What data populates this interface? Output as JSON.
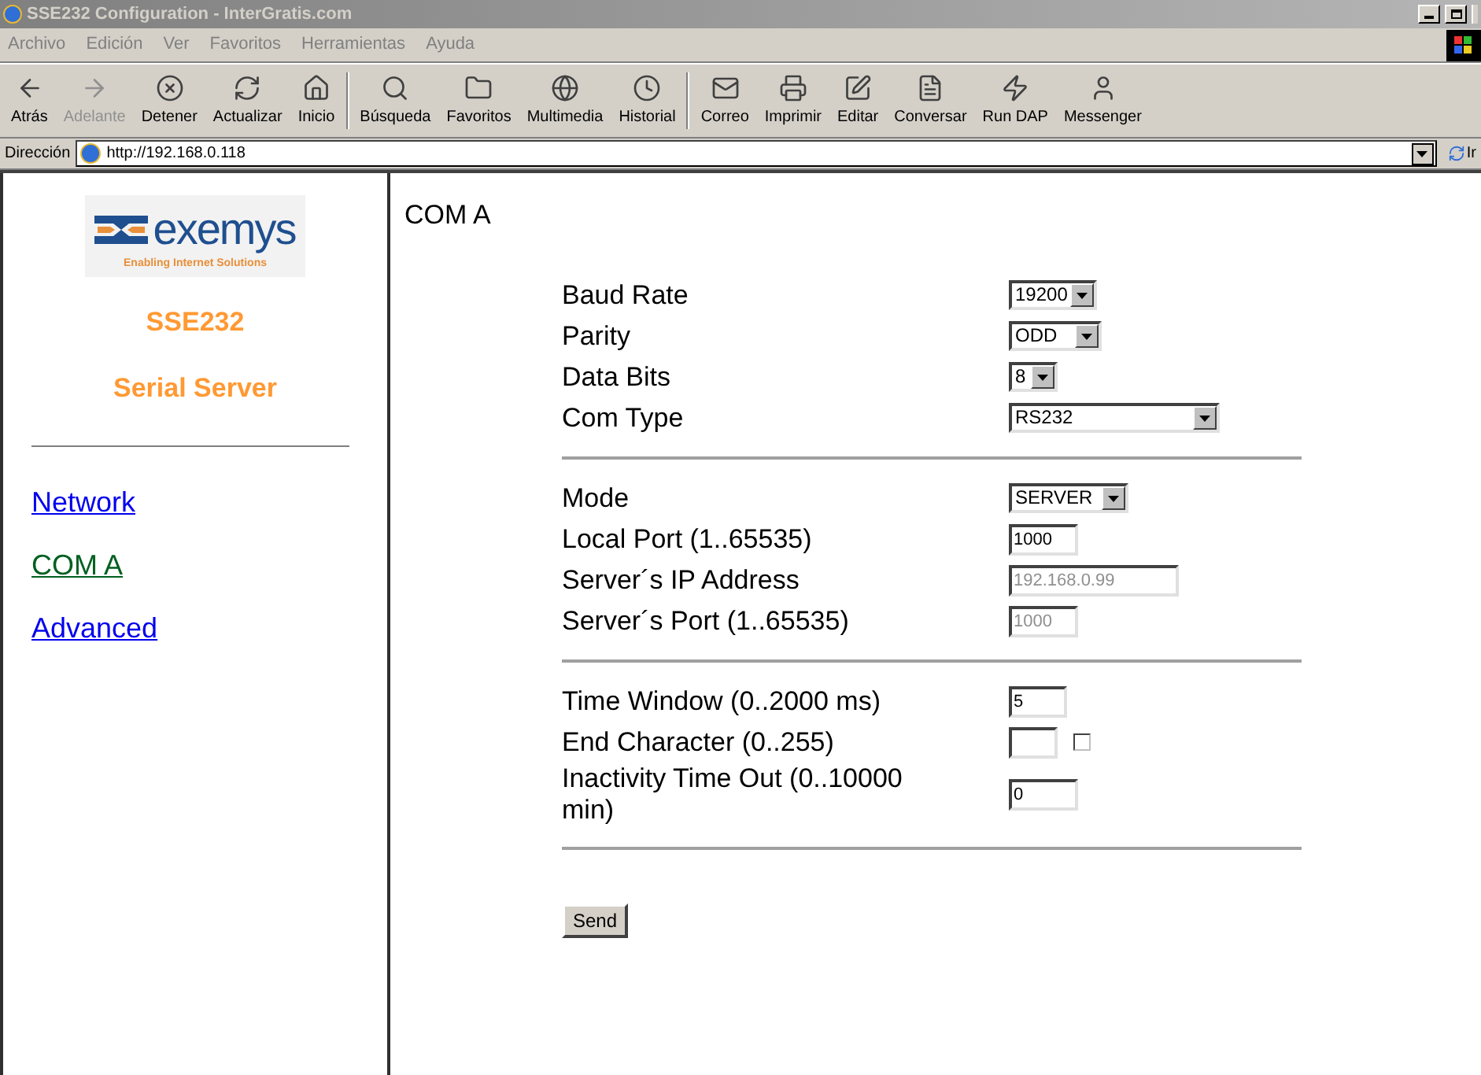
{
  "window": {
    "title": "SSE232 Configuration - InterGratis.com"
  },
  "menu": [
    "Archivo",
    "Edición",
    "Ver",
    "Favoritos",
    "Herramientas",
    "Ayuda"
  ],
  "toolbar": [
    {
      "label": "Atrás",
      "kind": "back",
      "disabled": false
    },
    {
      "label": "Adelante",
      "kind": "forward",
      "disabled": true
    },
    {
      "label": "Detener",
      "kind": "stop",
      "disabled": false
    },
    {
      "label": "Actualizar",
      "kind": "refresh",
      "disabled": false
    },
    {
      "label": "Inicio",
      "kind": "home",
      "disabled": false
    },
    {
      "label": "Búsqueda",
      "kind": "search",
      "disabled": false
    },
    {
      "label": "Favoritos",
      "kind": "favorites",
      "disabled": false
    },
    {
      "label": "Multimedia",
      "kind": "media",
      "disabled": false
    },
    {
      "label": "Historial",
      "kind": "history",
      "disabled": false
    },
    {
      "label": "Correo",
      "kind": "mail",
      "disabled": false
    },
    {
      "label": "Imprimir",
      "kind": "print",
      "disabled": false
    },
    {
      "label": "Editar",
      "kind": "edit",
      "disabled": false
    },
    {
      "label": "Conversar",
      "kind": "discuss",
      "disabled": false
    },
    {
      "label": "Run DAP",
      "kind": "dap",
      "disabled": false
    },
    {
      "label": "Messenger",
      "kind": "messenger",
      "disabled": false
    }
  ],
  "address_bar": {
    "label": "Dirección",
    "url": "http://192.168.0.118",
    "go": "Ir"
  },
  "sidebar": {
    "logo": {
      "name": "exemys",
      "tagline": "Enabling Internet Solutions"
    },
    "product": "SSE232",
    "subtitle": "Serial Server",
    "links": [
      {
        "label": "Network",
        "selected": false
      },
      {
        "label": "COM A",
        "selected": true
      },
      {
        "label": "Advanced",
        "selected": false
      }
    ]
  },
  "content": {
    "heading": "COM A",
    "groups": [
      [
        {
          "label": "Baud Rate",
          "kind": "select",
          "value": "19200"
        },
        {
          "label": "Parity",
          "kind": "select",
          "value": "ODD"
        },
        {
          "label": "Data Bits",
          "kind": "select",
          "value": "8"
        },
        {
          "label": "Com Type",
          "kind": "select",
          "value": "RS232"
        }
      ],
      [
        {
          "label": "Mode",
          "kind": "select",
          "value": "SERVER"
        },
        {
          "label": "Local Port (1..65535)",
          "kind": "input",
          "value": "1000",
          "disabled": false
        },
        {
          "label": "Server´s IP Address",
          "kind": "input",
          "value": "192.168.0.99",
          "disabled": true
        },
        {
          "label": "Server´s Port (1..65535)",
          "kind": "input",
          "value": "1000",
          "disabled": true
        }
      ],
      [
        {
          "label": "Time Window (0..2000 ms)",
          "kind": "input",
          "value": "5",
          "disabled": false
        },
        {
          "label": "End Character (0..255)",
          "kind": "input_checkbox",
          "checked": false
        },
        {
          "label": "Inactivity Time Out (0..10000 min)",
          "kind": "input",
          "value": "0",
          "disabled": false
        }
      ]
    ],
    "send": "Send"
  }
}
